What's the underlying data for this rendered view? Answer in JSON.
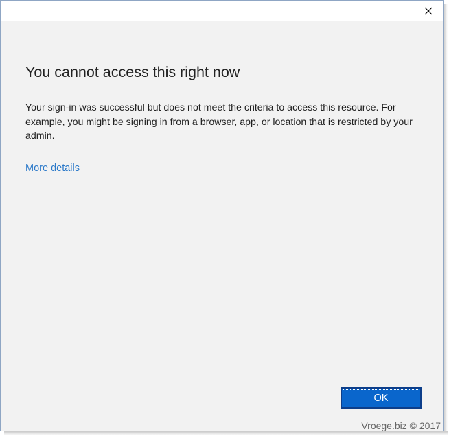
{
  "dialog": {
    "heading": "You cannot access this right now",
    "message": "Your sign-in was successful but does not meet the criteria to access this resource. For example, you might be signing in from a browser, app, or location that is restricted by your admin.",
    "more_details_label": "More details",
    "ok_label": "OK",
    "close_icon": "close-icon"
  },
  "watermark": "Vroege.biz © 2017",
  "colors": {
    "accent": "#0a66cc",
    "link": "#2b79c9",
    "background": "#f2f2f2"
  }
}
